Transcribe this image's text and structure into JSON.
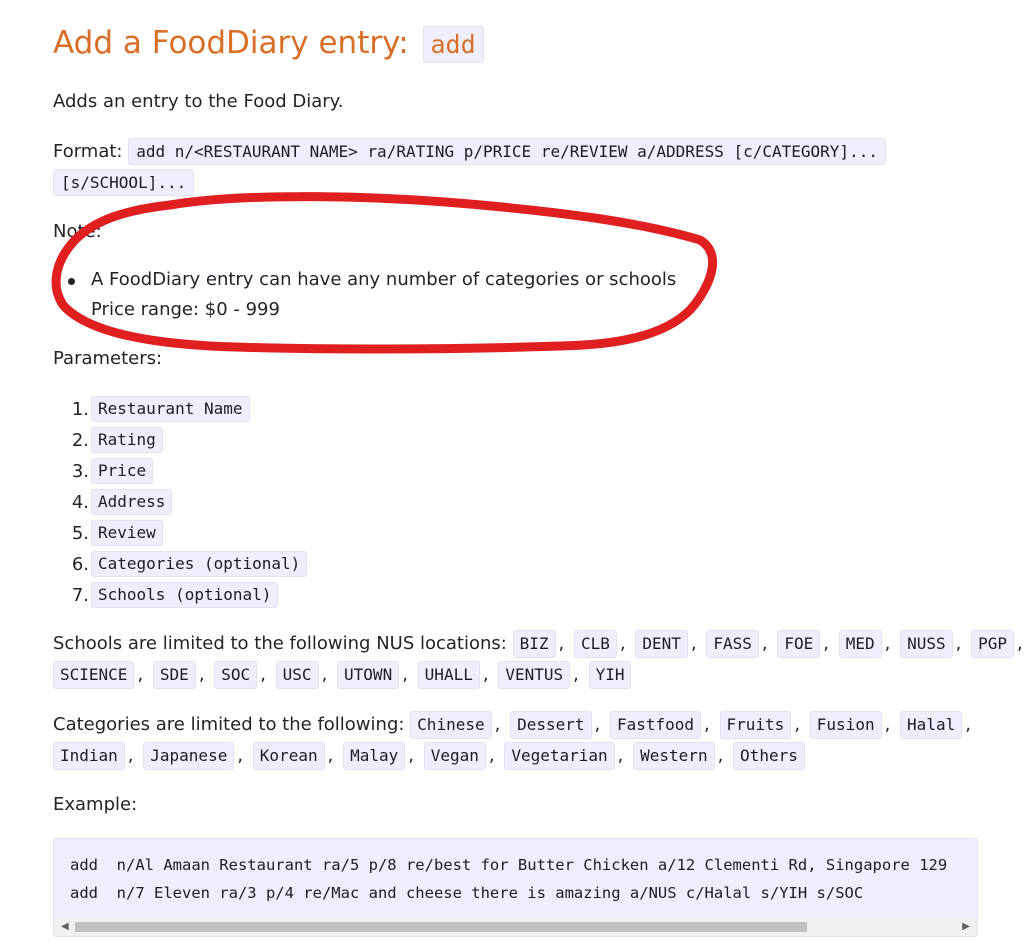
{
  "heading": {
    "text": "Add a FoodDiary entry:",
    "command": "add"
  },
  "description": "Adds an entry to the Food Diary.",
  "format": {
    "label": "Format:",
    "line1": "add n/<RESTAURANT NAME> ra/RATING p/PRICE re/REVIEW a/ADDRESS [c/CATEGORY]...",
    "line2": "[s/SCHOOL]..."
  },
  "note": {
    "label": "Note:",
    "line1": "A FoodDiary entry can have any number of categories or schools",
    "line2": "Price range: $0 - 999"
  },
  "parameters": {
    "label": "Parameters:",
    "items": [
      {
        "num": "1.",
        "text": "Restaurant Name"
      },
      {
        "num": "2.",
        "text": "Rating"
      },
      {
        "num": "3.",
        "text": "Price"
      },
      {
        "num": "4.",
        "text": "Address"
      },
      {
        "num": "5.",
        "text": "Review"
      },
      {
        "num": "6.",
        "text": "Categories (optional)"
      },
      {
        "num": "7.",
        "text": "Schools (optional)"
      }
    ]
  },
  "schools": {
    "label": "Schools are limited to the following NUS locations:",
    "items": [
      "BIZ",
      "CLB",
      "DENT",
      "FASS",
      "FOE",
      "MED",
      "NUSS",
      "PGP",
      "SCIENCE",
      "SDE",
      "SOC",
      "USC",
      "UTOWN",
      "UHALL",
      "VENTUS",
      "YIH"
    ]
  },
  "categories": {
    "label": "Categories are limited to the following:",
    "items": [
      "Chinese",
      "Dessert",
      "Fastfood",
      "Fruits",
      "Fusion",
      "Halal",
      "Indian",
      "Japanese",
      "Korean",
      "Malay",
      "Vegan",
      "Vegetarian",
      "Western",
      "Others"
    ]
  },
  "example": {
    "label": "Example:",
    "line1": "add  n/Al Amaan Restaurant ra/5 p/8 re/best for Butter Chicken a/12 Clementi Rd, Singapore 129",
    "line2": "add  n/7 Eleven ra/3 p/4 re/Mac and cheese there is amazing a/NUS c/Halal s/YIH s/SOC"
  },
  "separator": ",",
  "colors": {
    "heading": "#d96f27",
    "annotation": "#e02020",
    "code_bg": "#efeffb"
  },
  "icons": {
    "scroll_left": "scroll-left-arrow-icon",
    "scroll_right": "scroll-right-arrow-icon"
  }
}
